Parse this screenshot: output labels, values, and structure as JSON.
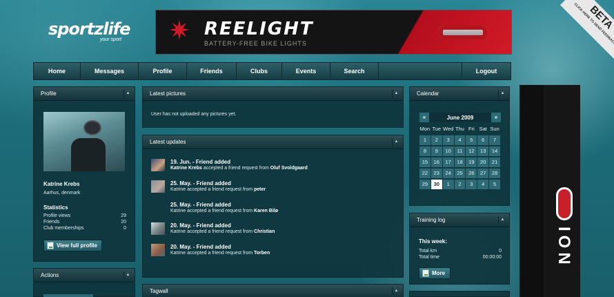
{
  "logo": {
    "name": "sportzlife",
    "sub": "your sport"
  },
  "banner": {
    "brand": "REELIGHT",
    "tagline": "BATTERY-FREE BIKE LIGHTS"
  },
  "beta": {
    "label": "BETA",
    "sub1": "CLICK HERE TO SEND FEEDBACK"
  },
  "nav": {
    "items": [
      "Home",
      "Messages",
      "Profile",
      "Friends",
      "Clubs",
      "Events",
      "Search"
    ],
    "logout": "Logout"
  },
  "profile": {
    "title": "Profile",
    "name": "Katrine Krebs",
    "location": "Aarhus, denmark",
    "stats_title": "Statistics",
    "stats": [
      {
        "label": "Profile views",
        "value": "29"
      },
      {
        "label": "Friends",
        "value": "20"
      },
      {
        "label": "Club memberships",
        "value": "0"
      }
    ],
    "button": "View full profile"
  },
  "actions": {
    "title": "Actions"
  },
  "pictures": {
    "title": "Latest pictures",
    "empty": "User has not uploaded any pictures yet."
  },
  "updates": {
    "title": "Latest updates",
    "items": [
      {
        "head": "19. Jun. - Friend added",
        "actor": "Katrine Krebs",
        "text": " accepted a friend request from ",
        "target": "Oluf Svoldgaard"
      },
      {
        "head": "25. May. - Friend added",
        "actor": "",
        "text": "Katrine accepted a friend request from ",
        "target": "peter"
      },
      {
        "head": "25. May. - Friend added",
        "actor": "",
        "text": "Katrine accepted a friend request from ",
        "target": "Karen Bilø"
      },
      {
        "head": "20. May. - Friend added",
        "actor": "",
        "text": "Katrine accepted a friend request from ",
        "target": "Christian"
      },
      {
        "head": "20. May. - Friend added",
        "actor": "",
        "text": "Katrine accepted a friend request from ",
        "target": "Torben"
      }
    ]
  },
  "tagwall": {
    "title": "Tagwall"
  },
  "calendar": {
    "title": "Calendar",
    "month": "June 2009",
    "prev": "«",
    "next": "»",
    "dow": [
      "Mon",
      "Tue",
      "Wed",
      "Thu",
      "Fri",
      "Sat",
      "Sun"
    ],
    "weeks": [
      [
        "1",
        "2",
        "3",
        "4",
        "5",
        "6",
        "7"
      ],
      [
        "8",
        "9",
        "10",
        "11",
        "12",
        "13",
        "14"
      ],
      [
        "15",
        "16",
        "17",
        "18",
        "19",
        "20",
        "21"
      ],
      [
        "22",
        "23",
        "24",
        "25",
        "26",
        "27",
        "28"
      ],
      [
        "29",
        "30",
        "1",
        "2",
        "3",
        "4",
        "5"
      ]
    ],
    "today": "30"
  },
  "training": {
    "title": "Training log",
    "week_label": "This week:",
    "rows": [
      {
        "label": "Total km",
        "value": "0"
      },
      {
        "label": "Total time",
        "value": "00:00:00"
      }
    ],
    "button": "More"
  },
  "ad": {
    "word": "ION"
  }
}
